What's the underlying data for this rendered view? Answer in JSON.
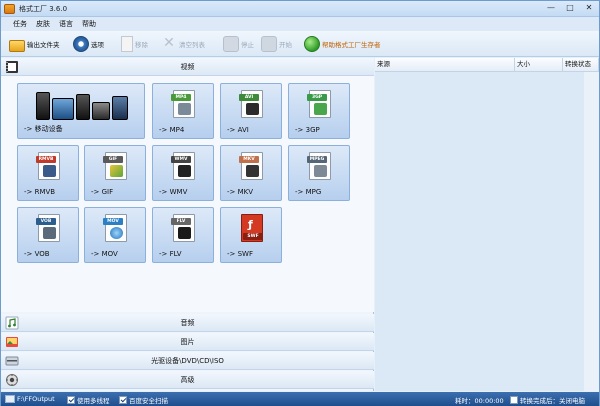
{
  "app": {
    "title": "格式工厂 3.6.0"
  },
  "window_controls": {
    "minimize": "—",
    "maximize": "□",
    "close": "✕"
  },
  "menu": [
    "任务",
    "皮肤",
    "语言",
    "帮助"
  ],
  "toolbar": {
    "output_folder": "输出文件夹",
    "options": "选项",
    "remove": "移除",
    "clear_list": "清空列表",
    "stop": "停止",
    "start": "开始",
    "link": "帮助格式工厂生存者"
  },
  "categories": {
    "video": "视频",
    "audio": "音频",
    "picture": "图片",
    "rom": "光驱设备\\DVD\\CD\\ISO",
    "advanced": "高级"
  },
  "video_tiles": [
    {
      "label": "-> 移动设备",
      "tag": "",
      "color": ""
    },
    {
      "label": "-> MP4",
      "tag": "MP4",
      "color": "#4a9a3c"
    },
    {
      "label": "-> AVI",
      "tag": "AVI",
      "color": "#3d8a3a"
    },
    {
      "label": "-> 3GP",
      "tag": "3GP",
      "color": "#3a9a4a"
    },
    {
      "label": "-> RMVB",
      "tag": "RMVB",
      "color": "#c0392b"
    },
    {
      "label": "-> GIF",
      "tag": "GIF",
      "color": "#5a5a5a"
    },
    {
      "label": "-> WMV",
      "tag": "WMV",
      "color": "#444444"
    },
    {
      "label": "-> MKV",
      "tag": "MKV",
      "color": "#c0704a"
    },
    {
      "label": "-> MPG",
      "tag": "MPEG",
      "color": "#556677"
    },
    {
      "label": "-> VOB",
      "tag": "VOB",
      "color": "#2b5e8c"
    },
    {
      "label": "-> MOV",
      "tag": "MOV",
      "color": "#2d7fc4"
    },
    {
      "label": "-> FLV",
      "tag": "FLV",
      "color": "#666666"
    },
    {
      "label": "-> SWF",
      "tag": "SWF",
      "color": "#c8321e"
    }
  ],
  "task_list": {
    "columns": [
      "来源",
      "大小",
      "转换状态"
    ]
  },
  "statusbar": {
    "output_path": "F:\\FFOutput",
    "multithread_label": "使用多线程",
    "multithread_checked": true,
    "safe_scan_label": "百度安全扫描",
    "safe_scan_checked": true,
    "elapsed": "耗时：00:00:00",
    "after_convert_label": "转换完成后：关闭电脑",
    "after_convert_checked": false
  },
  "colors": {
    "tile_border": "#8cb0dc",
    "statusbar": "#2a5c9a",
    "link": "#c06000"
  }
}
